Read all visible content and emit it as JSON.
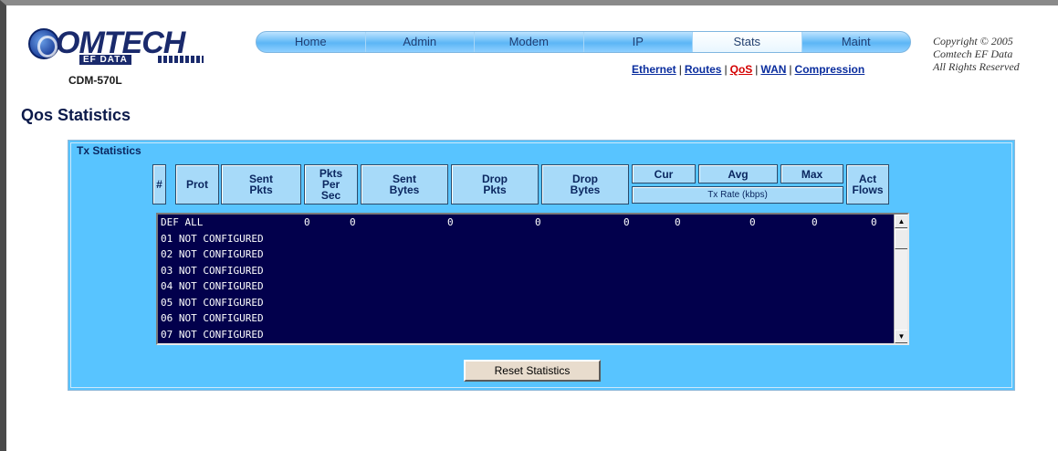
{
  "brand": {
    "logo_text": "OMTECH",
    "logo_sub": "EF DATA",
    "model": "CDM-570L"
  },
  "nav": {
    "tabs": [
      "Home",
      "Admin",
      "Modem",
      "IP",
      "Stats",
      "Maint"
    ],
    "active": "Stats"
  },
  "subnav": {
    "links": [
      "Ethernet",
      "Routes",
      "QoS",
      "WAN",
      "Compression"
    ],
    "current": "QoS"
  },
  "copyright": {
    "line1": "Copyright © 2005",
    "line2": "Comtech EF Data",
    "line3": "All Rights Reserved"
  },
  "page_title": "Qos Statistics",
  "panel": {
    "title": "Tx Statistics",
    "headers": {
      "num": "#",
      "prot": "Prot",
      "sent_pkts": "Sent\nPkts",
      "pkts_per_sec": "Pkts\nPer\nSec",
      "sent_bytes": "Sent\nBytes",
      "drop_pkts": "Drop\nPkts",
      "drop_bytes": "Drop\nBytes",
      "cur": "Cur",
      "avg": "Avg",
      "max": "Max",
      "tx_rate": "Tx Rate (kbps)",
      "act_flows": "Act\nFlows"
    },
    "rows": [
      {
        "label": "DEF ALL",
        "values": [
          "0",
          "0",
          "0",
          "0",
          "0",
          "0",
          "0",
          "0",
          "0"
        ]
      },
      {
        "label": "01 NOT CONFIGURED",
        "values": []
      },
      {
        "label": "02 NOT CONFIGURED",
        "values": []
      },
      {
        "label": "03 NOT CONFIGURED",
        "values": []
      },
      {
        "label": "04 NOT CONFIGURED",
        "values": []
      },
      {
        "label": "05 NOT CONFIGURED",
        "values": []
      },
      {
        "label": "06 NOT CONFIGURED",
        "values": []
      },
      {
        "label": "07 NOT CONFIGURED",
        "values": []
      }
    ],
    "reset_label": "Reset Statistics"
  }
}
